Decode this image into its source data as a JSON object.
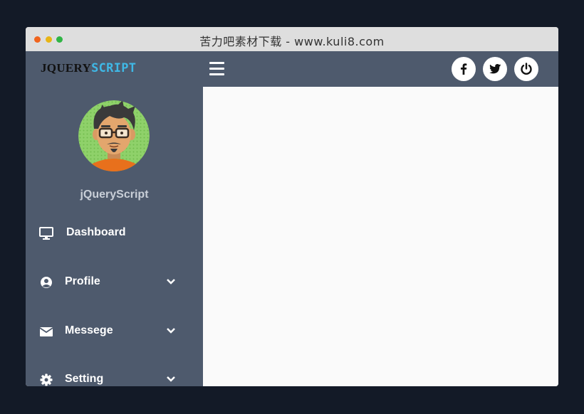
{
  "window": {
    "title": "苦力吧素材下载 - www.kuli8.com"
  },
  "brand": {
    "part1": "JQUERY",
    "part2": "SCRIPT",
    "accent_color": "#3fb8e6"
  },
  "user": {
    "name": "jQueryScript",
    "avatar_icon": "cartoon-avatar"
  },
  "menu": [
    {
      "label": "Dashboard",
      "icon": "desktop-icon",
      "has_submenu": false
    },
    {
      "label": "Profile",
      "icon": "user-circle-icon",
      "has_submenu": true
    },
    {
      "label": "Messege",
      "icon": "envelope-icon",
      "has_submenu": true
    },
    {
      "label": "Setting",
      "icon": "gear-icon",
      "has_submenu": true
    }
  ],
  "topbar": {
    "menu_toggle_icon": "hamburger-icon",
    "social": [
      "facebook-icon",
      "twitter-icon",
      "power-icon"
    ]
  },
  "colors": {
    "sidebar": "#4e5a6d",
    "content": "#fafafa",
    "page_background": "#131a27"
  }
}
